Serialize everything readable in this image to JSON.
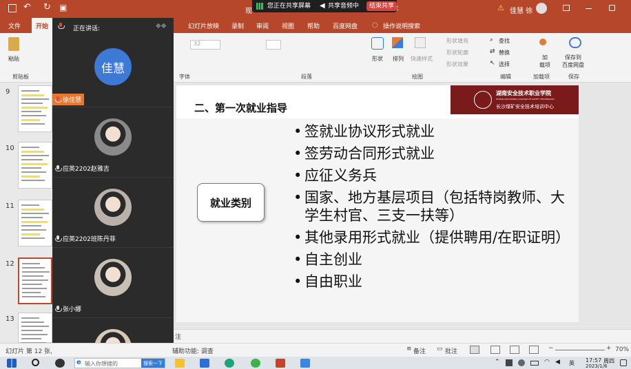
{
  "window": {
    "title_fragment": "现",
    "title_suffix": "nt",
    "user_name": "佳慧 徐",
    "warning": "⚠"
  },
  "share_bar": {
    "status": "您正在共享屏幕",
    "audio": "共享音频中",
    "stop": "结束共享"
  },
  "ribbon_tabs": {
    "file": "文件",
    "home": "开始",
    "slideshow": "幻灯片放映",
    "record": "录制",
    "review": "审阅",
    "view": "视图",
    "help": "帮助",
    "baidu": "百度网盘",
    "search_hint": "操作说明搜索"
  },
  "ribbon": {
    "paste": "粘贴",
    "clipboard": "剪贴板",
    "font_size": "32",
    "font_group": "字体",
    "paragraph_group": "段落",
    "shape": "形状",
    "arrange": "排列",
    "quick_style": "快速样式",
    "fill": "形状填充",
    "outline": "形状轮廓",
    "effect": "形状效果",
    "drawing_group": "绘图",
    "find": "查找",
    "replace": "替换",
    "select": "选择",
    "editing_group": "编辑",
    "addin": "加\n载项",
    "addin_group": "加载项",
    "save_baidu": "保存到\n百度网盘",
    "save_group": "保存"
  },
  "thumbnails": [
    {
      "num": "9"
    },
    {
      "num": "10"
    },
    {
      "num": "11"
    },
    {
      "num": "12"
    },
    {
      "num": "13"
    }
  ],
  "panel": {
    "speaking_label": "正在讲话:",
    "participants": [
      {
        "name": "徐佳慧",
        "avatar_text": "佳慧",
        "speaking": true
      },
      {
        "name": "应英2202赵雅吉",
        "speaking": false
      },
      {
        "name": "应英2202班陈丹菲",
        "speaking": false
      },
      {
        "name": "张小娜",
        "speaking": false
      },
      {
        "name": "",
        "speaking": false
      }
    ]
  },
  "slide": {
    "title": "二、第一次就业指导",
    "logo_cn": "湖南安全技术职业学院",
    "logo_en": "HUNAN VOCATIONAL COLLEGE OF SAFETY TECHNOLOGY",
    "logo_sub": "长沙煤矿安全技术培训中心",
    "category": "就业类别",
    "bullets": [
      "签就业协议形式就业",
      "签劳动合同形式就业",
      "应征义务兵",
      "国家、地方基层项目（包括特岗教师、大学生村官、三支一扶等）",
      "其他录用形式就业（提供聘用/在职证明）",
      "自主创业",
      "自由职业"
    ]
  },
  "notes": {
    "label": "注"
  },
  "status": {
    "slide_info": "幻灯片 第 12 张,",
    "accessibility": "辅助功能: 调查",
    "notes": "备注",
    "comments": "批注",
    "zoom": "70%"
  },
  "taskbar": {
    "search_placeholder": "输入你想搜的",
    "search_button": "搜索一下",
    "time": "17:57",
    "weekday": "周四",
    "date": "2023/1/6"
  },
  "colors": {
    "accent": "#b7472a",
    "logo_red": "#7a1a1a",
    "avatar_blue": "#3d7ad6"
  }
}
